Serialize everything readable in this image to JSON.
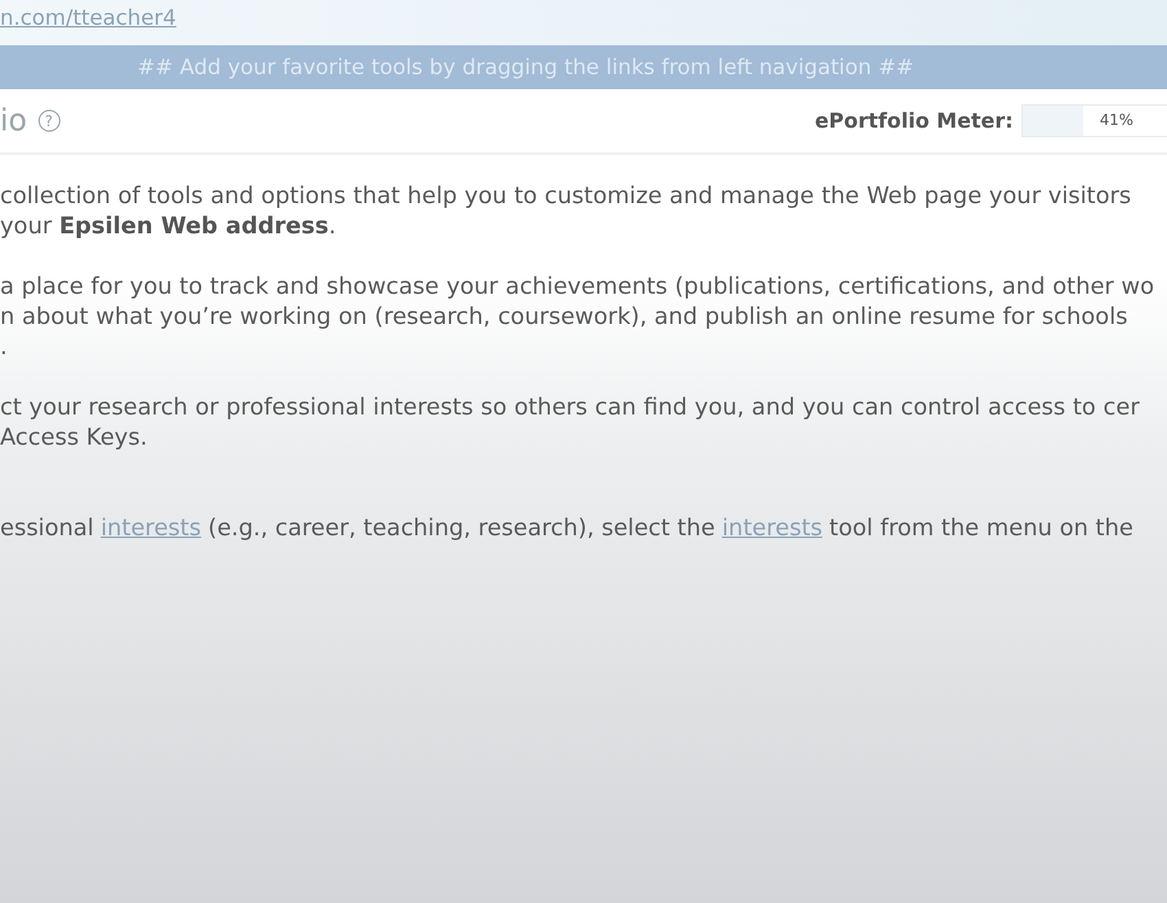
{
  "header": {
    "url_link": "n.com/tteacher4"
  },
  "banner": {
    "text": "## Add your favorite tools by dragging the links from left navigation ##"
  },
  "section": {
    "title": "io",
    "help_icon": "?",
    "meter": {
      "label": "ePortfolio Meter:",
      "level": 0.41,
      "reading": "41%"
    }
  },
  "paragraphs": [
    {
      "lines": [
        [
          {
            "kind": "text",
            "text": "collection of tools and options that help you to customize and manage the Web page your visitors"
          }
        ],
        [
          {
            "kind": "text",
            "text": "your **Epsilen Web address**."
          }
        ]
      ]
    },
    {
      "lines": [
        [
          {
            "kind": "text",
            "text": "a place for you to track and showcase your achievements (publications, certifications, and other wo"
          }
        ],
        [
          {
            "kind": "text",
            "text": "n about what you’re working on (research, coursework), and publish an online resume for schools"
          }
        ],
        [
          {
            "kind": "text",
            "text": "."
          }
        ]
      ]
    },
    {
      "lines": [
        [
          {
            "kind": "text",
            "text": "ct your research or professional interests so others can find you, and you can control access to cer"
          }
        ],
        [
          {
            "kind": "text",
            "text": "Access Keys."
          }
        ]
      ]
    },
    {
      "lines": [
        [
          {
            "kind": "text",
            "text": "essional"
          },
          {
            "kind": "link",
            "text": "interests"
          },
          {
            "kind": "text",
            "text": "(e.g., career, teaching, research), select the"
          },
          {
            "kind": "link",
            "text": "interests"
          },
          {
            "kind": "text",
            "text": "tool from the menu on the"
          }
        ]
      ]
    }
  ]
}
